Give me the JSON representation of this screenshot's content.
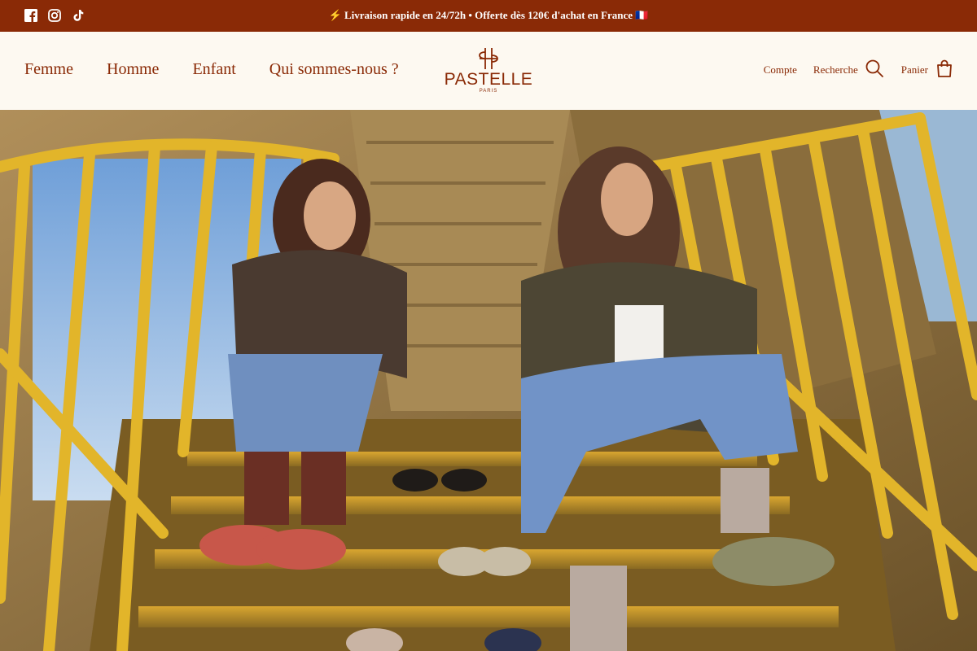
{
  "announcement": {
    "text": "⚡ Livraison rapide en 24/72h • Offerte dès 120€ d'achat en France 🇫🇷",
    "social_icons": [
      "facebook-icon",
      "instagram-icon",
      "tiktok-icon"
    ]
  },
  "nav": {
    "items": [
      {
        "label": "Femme"
      },
      {
        "label": "Homme"
      },
      {
        "label": "Enfant"
      },
      {
        "label": "Qui sommes-nous ?"
      }
    ]
  },
  "logo": {
    "brand": "PASTELLE",
    "city": "PARIS"
  },
  "header_actions": {
    "account_label": "Compte",
    "search_label": "Recherche",
    "cart_label": "Panier"
  },
  "colors": {
    "brand": "#8a2a06",
    "background": "#fdf9f1",
    "announcement_text": "#ffffff"
  },
  "hero": {
    "image": "hero-photo"
  }
}
